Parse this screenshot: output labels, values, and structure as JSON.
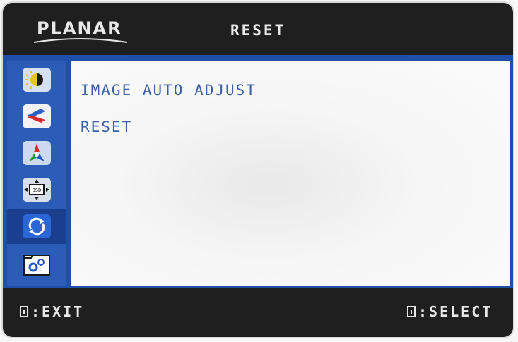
{
  "header": {
    "brand": "PLANAR",
    "menu_title": "RESET"
  },
  "sidebar": {
    "items": [
      {
        "icon": "brightness-contrast-icon",
        "active": false
      },
      {
        "icon": "image-position-icon",
        "active": false
      },
      {
        "icon": "color-icon",
        "active": false
      },
      {
        "icon": "osd-settings-icon",
        "active": false
      },
      {
        "icon": "reset-icon",
        "active": true
      },
      {
        "icon": "system-settings-icon",
        "active": false
      }
    ]
  },
  "content": {
    "items": [
      "IMAGE AUTO ADJUST",
      "RESET"
    ]
  },
  "footer": {
    "exit_hint": ":EXIT",
    "select_hint": ":SELECT"
  },
  "colors": {
    "frame_blue": "#1f4fa8",
    "text_blue": "#3a5fa4",
    "active_blue": "#1a3f8f",
    "header_bg": "#1f1f1f"
  }
}
